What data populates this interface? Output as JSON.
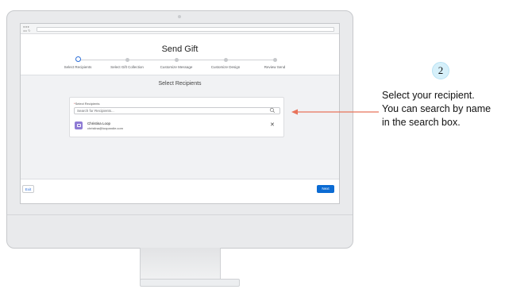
{
  "modal": {
    "title": "Send Gift",
    "steps": [
      "Select Recipients",
      "Select Gift Collection",
      "Customize Message",
      "Customize Design",
      "Review Send"
    ],
    "active_step": 0
  },
  "section_title": "Select Recipients",
  "recipients_field": {
    "required_marker": "*",
    "label": "Select Recipients",
    "placeholder": "Search for Recipients..."
  },
  "selected_recipient": {
    "name": "Christina Loop",
    "email": "christina@loopandie.com"
  },
  "footer": {
    "exit_label": "Exit",
    "next_label": "Next"
  },
  "callout": {
    "step_number": "2",
    "lines": [
      "Select your recipient.",
      "You can search by name",
      "in the search box."
    ],
    "arrow_color": "#e8735a"
  },
  "colors": {
    "accent": "#0b6bd3",
    "active_step": "#2b6ed8",
    "avatar": "#8e7bd4",
    "badge_bg": "#d6f0fa"
  }
}
